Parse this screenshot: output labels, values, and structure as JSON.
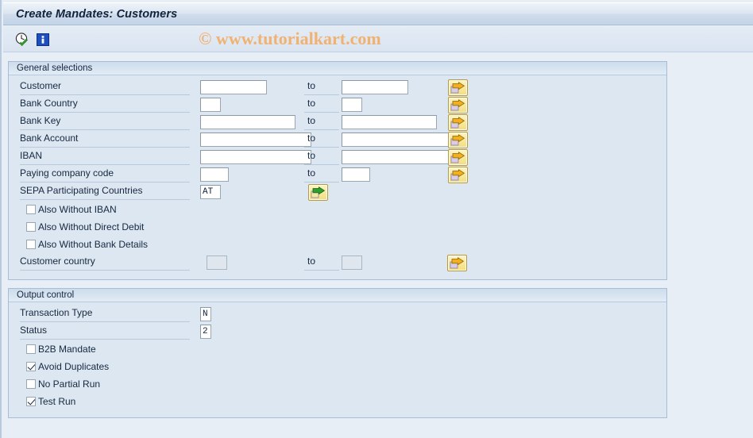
{
  "window": {
    "title": "Create Mandates: Customers"
  },
  "toolbar": {
    "execute_icon": "clock-check-icon",
    "info_icon": "info-icon"
  },
  "watermark": {
    "text": "© www.tutorialkart.com",
    "color": "#f0b273"
  },
  "colors": {
    "panel_bg": "#dce7f1",
    "panel_border": "#a8bdd4",
    "page_bg": "#e8eef5",
    "button_yellow": "#f8e89a"
  },
  "general_selections": {
    "header": "General selections",
    "to_label": "to",
    "rows": [
      {
        "label": "Customer",
        "from_value": "",
        "to_value": "",
        "field_width": 84,
        "has_multiselect": true,
        "multiselect_icon": "arrow-right-select-icon",
        "disabled": false
      },
      {
        "label": "Bank Country",
        "from_value": "",
        "to_value": "",
        "field_width": 26,
        "has_multiselect": true,
        "multiselect_icon": "arrow-right-select-icon",
        "disabled": false
      },
      {
        "label": "Bank Key",
        "from_value": "",
        "to_value": "",
        "field_width": 120,
        "has_multiselect": true,
        "multiselect_icon": "arrow-right-select-icon",
        "disabled": false
      },
      {
        "label": "Bank Account",
        "from_value": "",
        "to_value": "",
        "field_width": 140,
        "has_multiselect": true,
        "multiselect_icon": "arrow-right-select-icon",
        "disabled": false
      },
      {
        "label": "IBAN",
        "from_value": "",
        "to_value": "",
        "field_width": 140,
        "has_multiselect": true,
        "multiselect_icon": "arrow-right-select-icon",
        "disabled": false
      },
      {
        "label": "Paying company code",
        "from_value": "",
        "to_value": "",
        "field_width": 36,
        "has_multiselect": true,
        "multiselect_icon": "arrow-right-select-icon",
        "disabled": false
      }
    ],
    "sepa_row": {
      "label": "SEPA Participating Countries",
      "value": "AT",
      "field_width": 26,
      "multiselect_icon": "arrow-right-green-select-icon"
    },
    "checkboxes": [
      {
        "label": "Also Without IBAN",
        "checked": false
      },
      {
        "label": "Also Without Direct Debit",
        "checked": false
      },
      {
        "label": "Also Without Bank Details",
        "checked": false
      }
    ],
    "customer_country_row": {
      "label": "Customer country",
      "from_value": "",
      "to_value": "",
      "field_width": 26,
      "has_multiselect": true,
      "multiselect_icon": "arrow-right-select-icon",
      "disabled": true
    }
  },
  "output_control": {
    "header": "Output control",
    "rows": [
      {
        "label": "Transaction Type",
        "value": "N",
        "field_width": 14
      },
      {
        "label": "Status",
        "value": "2",
        "field_width": 14
      }
    ],
    "checkboxes": [
      {
        "label": "B2B Mandate",
        "checked": false
      },
      {
        "label": "Avoid Duplicates",
        "checked": true
      },
      {
        "label": "No Partial Run",
        "checked": false
      },
      {
        "label": "Test Run",
        "checked": true
      }
    ]
  }
}
